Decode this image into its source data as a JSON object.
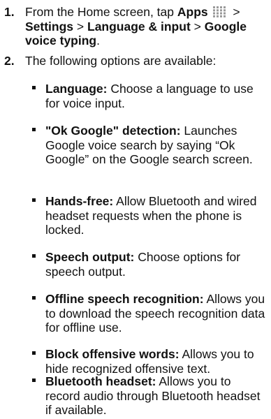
{
  "steps": [
    {
      "number": "1.",
      "pre": "From the Home screen, tap",
      "apps": "Apps",
      "sep1": " > ",
      "settings": "Settings",
      "sep2": " > ",
      "language_input": "Language & input",
      "sep3": " > ",
      "voice_typing": "Google voice typing",
      "end": "."
    },
    {
      "number": "2.",
      "text": "The following options are available:"
    }
  ],
  "options": [
    {
      "term": "Language:",
      "desc": " Choose a language to use for voice input."
    },
    {
      "term": "\"Ok Google\" detection:",
      "desc": " Launches Google voice search by saying “Ok Google” on the Google search screen."
    },
    {
      "term": "Hands-free:",
      "desc": " Allow Bluetooth and wired headset requests when the phone is locked."
    },
    {
      "term": "Speech output:",
      "desc": " Choose options for speech output."
    },
    {
      "term": "Offline speech recognition:",
      "desc": " Allows you to download the speech recognition data for offline use."
    },
    {
      "term": "Block offensive words:",
      "desc": " Allows you to hide recognized offensive text."
    },
    {
      "term": "Bluetooth headset:",
      "desc": " Allows you to record audio through Bluetooth headset if available."
    }
  ],
  "icons": {
    "apps_grid": "apps-grid-icon",
    "apps_grid_color": "#9a9a9a"
  }
}
